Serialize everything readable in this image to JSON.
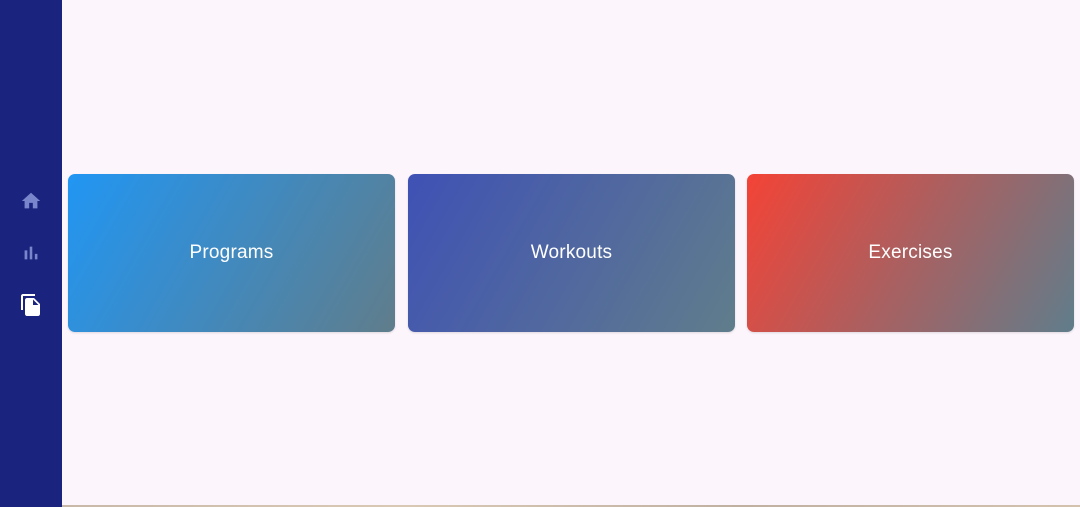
{
  "nav": {
    "items": [
      {
        "icon": "home-icon",
        "label": "Home",
        "selected": false
      },
      {
        "icon": "bar-chart-icon",
        "label": "Stats",
        "selected": false
      },
      {
        "icon": "file-copy-icon",
        "label": "Library",
        "selected": true
      }
    ],
    "colors": {
      "rail_background": "#1A237E",
      "icon_inactive": "#7986CB",
      "icon_active": "#FFFFFF"
    }
  },
  "cards": [
    {
      "label": "Programs",
      "gradient_start": "#2196F3",
      "gradient_end": "#607D8B"
    },
    {
      "label": "Workouts",
      "gradient_start": "#3F51B5",
      "gradient_end": "#607D8B"
    },
    {
      "label": "Exercises",
      "gradient_start": "#F44336",
      "gradient_end": "#607D8B"
    }
  ],
  "page": {
    "background": "#FCF6FC"
  }
}
